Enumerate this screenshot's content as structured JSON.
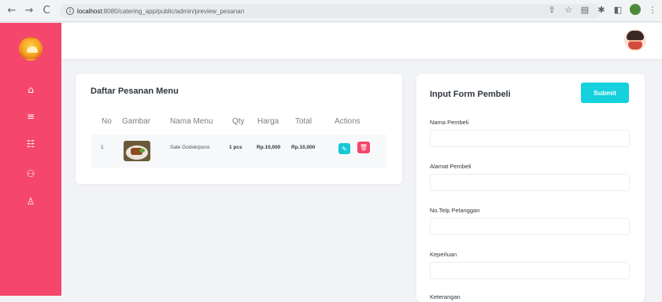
{
  "browser": {
    "url_host": "localhost",
    "url_path": ":8080/catering_app/public/admin/preview_pesanan",
    "icons": [
      "back-icon",
      "forward-icon",
      "reload-icon",
      "info-icon",
      "share-icon",
      "star-icon",
      "extension-icon",
      "puzzle-icon",
      "sidebar-icon",
      "profile-icon",
      "menu-icon"
    ]
  },
  "sidebar": {
    "color": "#f5476b",
    "items": [
      {
        "icon": "home-icon",
        "glyph": "⌂"
      },
      {
        "icon": "list-icon",
        "glyph": "≡"
      },
      {
        "icon": "menu-book-icon",
        "glyph": "☷"
      },
      {
        "icon": "users-icon",
        "glyph": "⚇"
      },
      {
        "icon": "user-icon",
        "glyph": "♙"
      }
    ]
  },
  "left_card": {
    "title": "Daftar Pesanan Menu",
    "columns": [
      "No",
      "Gambar",
      "Nama Menu",
      "Qty",
      "Harga",
      "Total",
      "Actions"
    ],
    "rows": [
      {
        "no": "1",
        "nama_menu": "Sate Godok/porsi",
        "qty": "1 pcs",
        "harga": "Rp.10,000",
        "total": "Rp.10,000"
      }
    ]
  },
  "right_card": {
    "title": "Input Form Pembeli",
    "submit_label": "Submit",
    "fields": [
      {
        "label": "Nama Pembeli",
        "value": ""
      },
      {
        "label": "Alamat Pembeli",
        "value": ""
      },
      {
        "label": "No.Telp Pelanggan",
        "value": ""
      },
      {
        "label": "Keperluan",
        "value": ""
      },
      {
        "label": "Keterangan",
        "value": ""
      }
    ]
  },
  "colors": {
    "accent": "#14d1dd",
    "danger": "#f5476b"
  }
}
